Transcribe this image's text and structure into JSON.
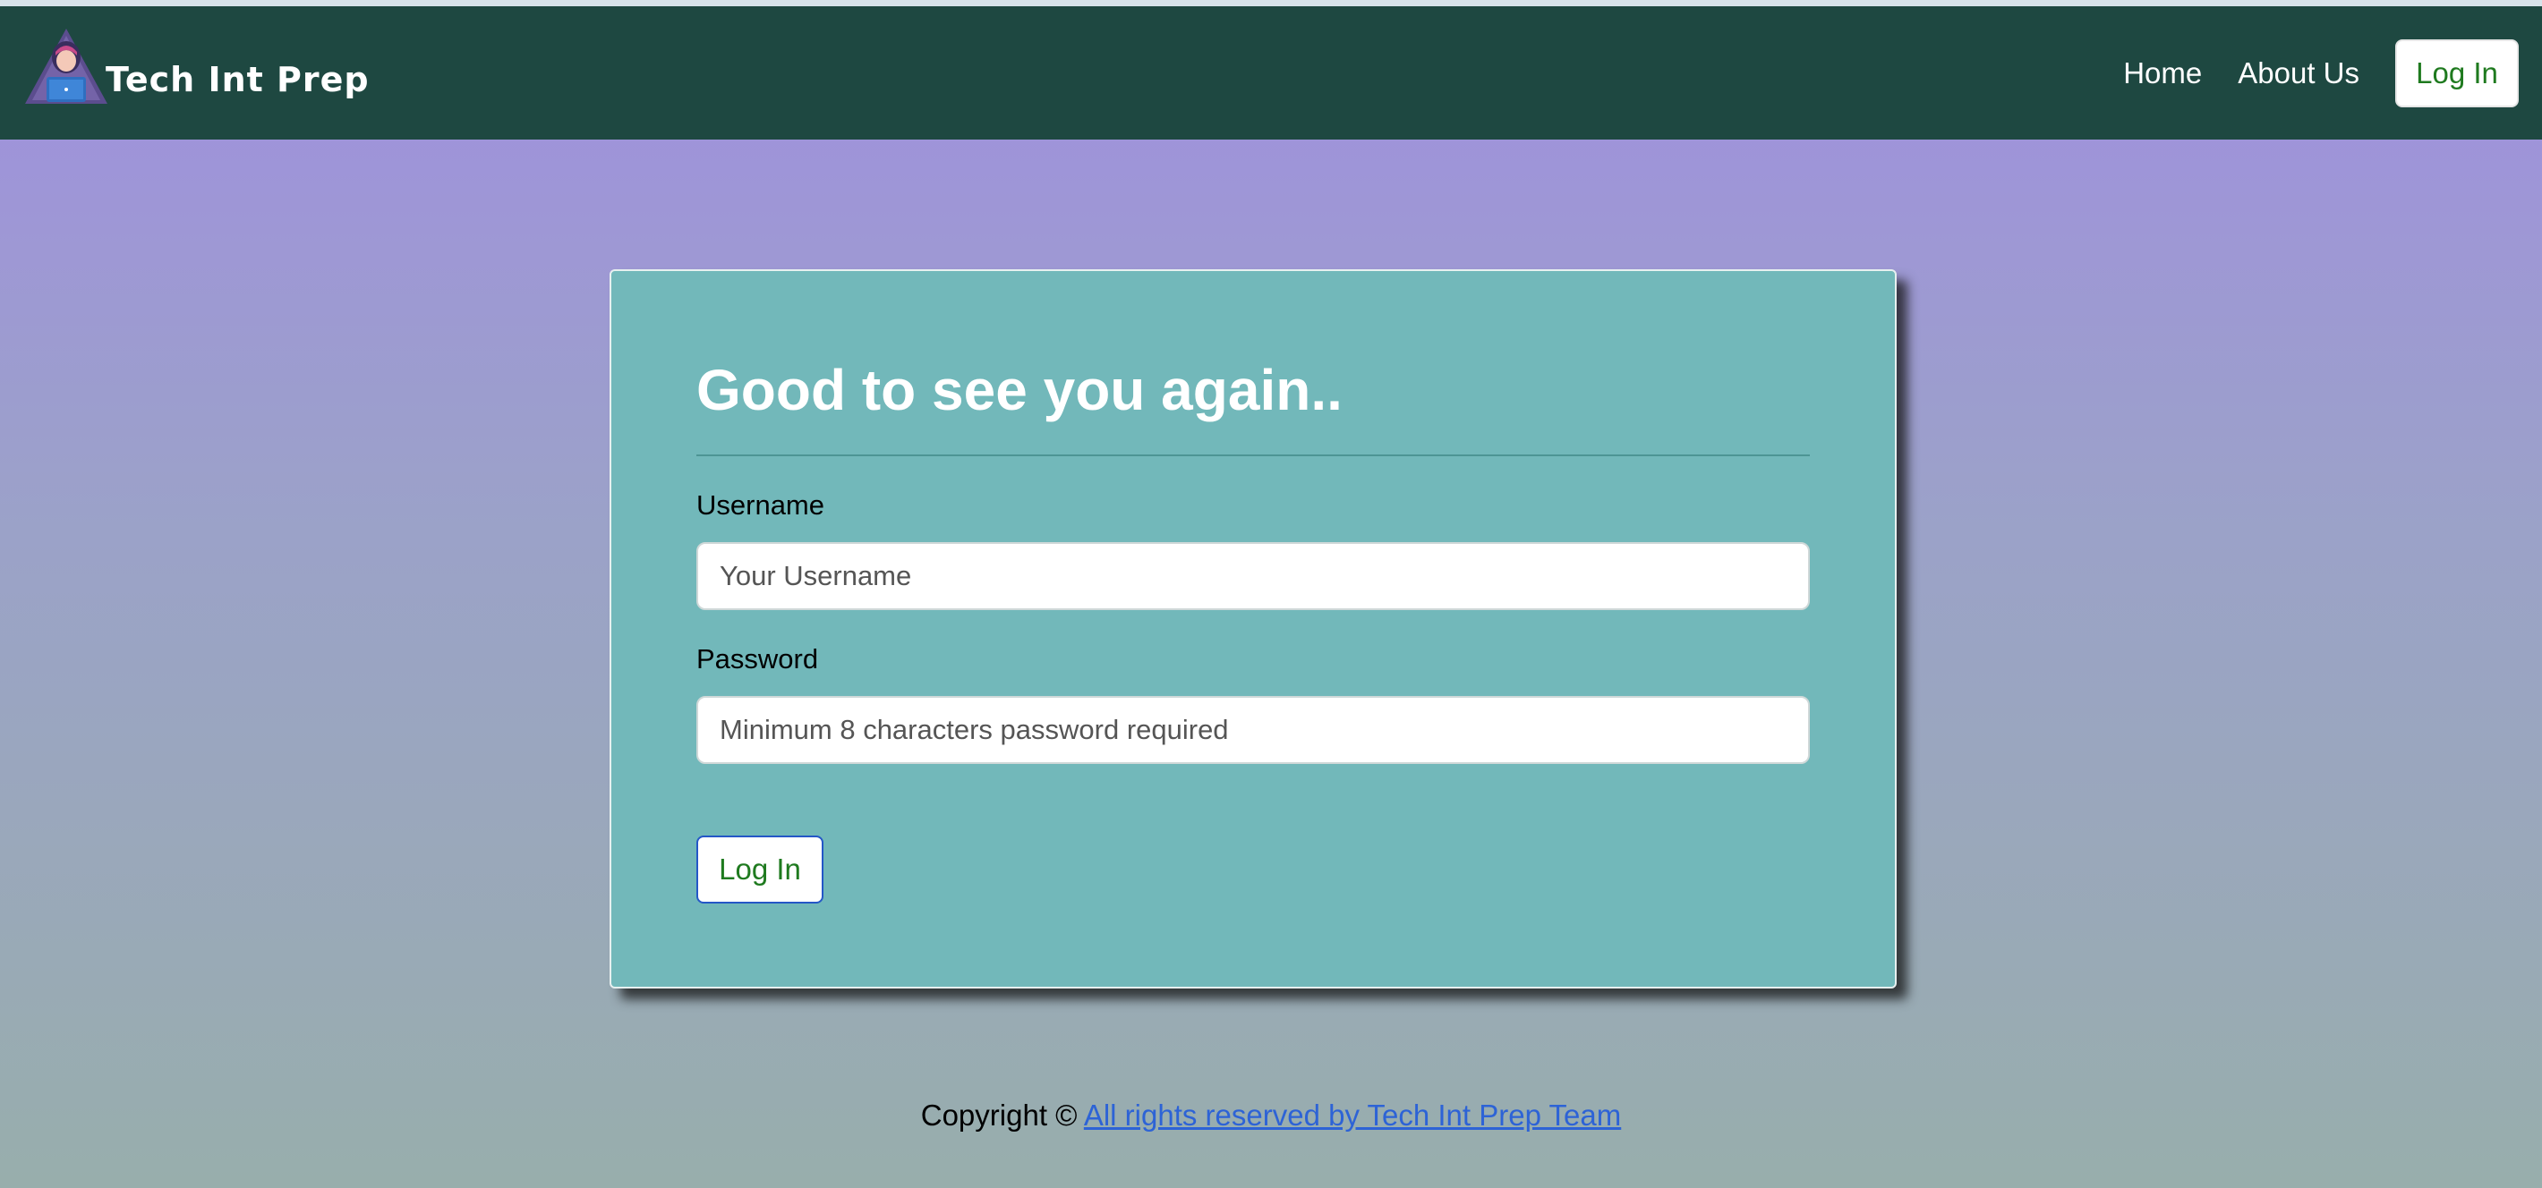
{
  "brand": {
    "name": "Tech Int Prep",
    "logo_icon": "hooded-hacker-laptop-icon"
  },
  "nav": {
    "links": [
      {
        "label": "Home"
      },
      {
        "label": "About Us"
      }
    ],
    "login_label": "Log In"
  },
  "login_card": {
    "title": "Good to see you again..",
    "username": {
      "label": "Username",
      "placeholder": "Your Username",
      "value": ""
    },
    "password": {
      "label": "Password",
      "placeholder": "Minimum 8 characters password required",
      "value": ""
    },
    "submit_label": "Log In"
  },
  "footer": {
    "prefix": "Copyright ©",
    "link_text": "All rights reserved by Tech Int Prep Team"
  },
  "colors": {
    "navbar": "#1e4841",
    "card": "#72b8ba",
    "background_top": "#a08fdf",
    "background_bottom": "#98aeac",
    "login_text": "#1f7a1f",
    "link": "#2d63d6"
  }
}
